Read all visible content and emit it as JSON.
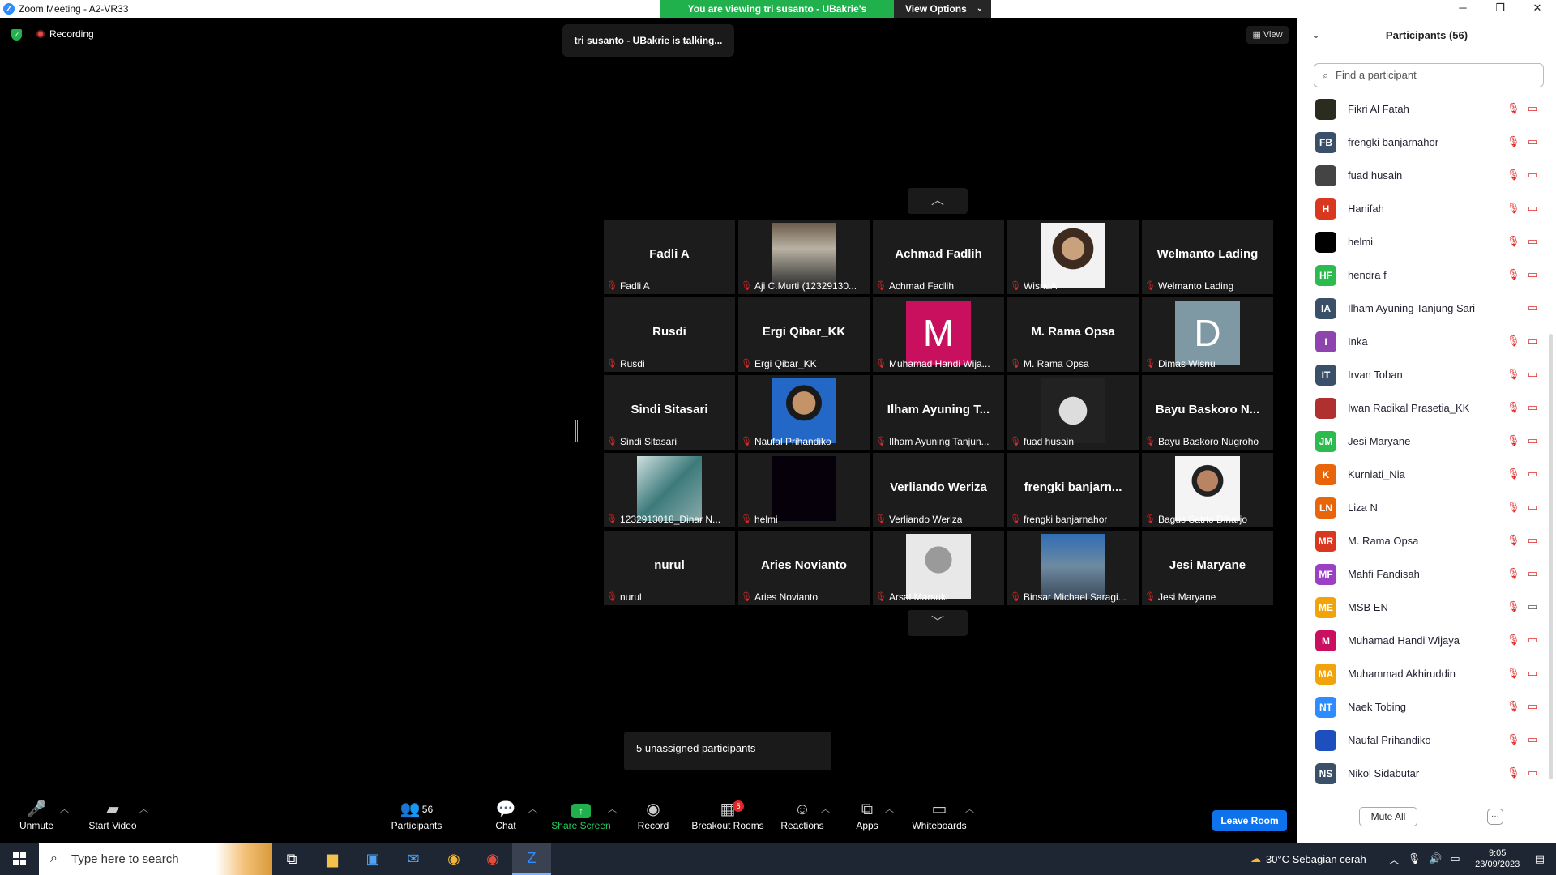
{
  "titlebar": {
    "title": "Zoom Meeting - A2-VR33",
    "banner_text": "You are viewing tri susanto - UBakrie's screen",
    "view_options": "View Options"
  },
  "meeting": {
    "recording_label": "Recording",
    "talking_text": "tri susanto - UBakrie is talking...",
    "view_label": "View",
    "unassigned_text": "5 unassigned participants"
  },
  "tiles": [
    {
      "big": "Fadli A",
      "label": "Fadli A"
    },
    {
      "photo": "photo",
      "label": "Aji C.Murti (12329130..."
    },
    {
      "big": "Achmad Fadlih",
      "label": "Achmad Fadlih"
    },
    {
      "photo": "photo",
      "label": "WisnuA"
    },
    {
      "big": "Welmanto Lading",
      "label": "Welmanto Lading"
    },
    {
      "big": "Rusdi",
      "label": "Rusdi"
    },
    {
      "big": "Ergi Qibar_KK",
      "label": "Ergi Qibar_KK"
    },
    {
      "letter": "M",
      "letter_color": "#c8105e",
      "label": "Muhamad Handi Wija..."
    },
    {
      "big": "M. Rama Opsa",
      "label": "M. Rama Opsa"
    },
    {
      "letter": "D",
      "letter_color": "#7e98a4",
      "label": "Dimas Wisnu"
    },
    {
      "big": "Sindi Sitasari",
      "label": "Sindi Sitasari"
    },
    {
      "photo": "photo",
      "label": "Naufal Prihandiko"
    },
    {
      "big": "Ilham Ayuning T...",
      "label": "Ilham Ayuning Tanjun..."
    },
    {
      "photo": "photo",
      "label": "fuad husain"
    },
    {
      "big": "Bayu Baskoro N...",
      "label": "Bayu Baskoro Nugroho"
    },
    {
      "photo": "photo",
      "label": "1232913018_Dinar N..."
    },
    {
      "photo": "photo",
      "label": "helmi"
    },
    {
      "big": "Verliando Weriza",
      "label": "Verliando Weriza"
    },
    {
      "big": "frengki  banjarn...",
      "label": "frengki banjarnahor"
    },
    {
      "photo": "photo",
      "label": "Bagus Satrio Diharjo"
    },
    {
      "big": "nurul",
      "label": "nurul"
    },
    {
      "big": "Aries Novianto",
      "label": "Aries Novianto"
    },
    {
      "photo": "photo",
      "label": "Arsal Marsuki"
    },
    {
      "photo": "photo",
      "label": "Binsar Michael Saragi..."
    },
    {
      "big": "Jesi Maryane",
      "label": "Jesi Maryane"
    }
  ],
  "toolbar": {
    "unmute": "Unmute",
    "start_video": "Start Video",
    "participants": "Participants",
    "participants_count": "56",
    "chat": "Chat",
    "share_screen": "Share Screen",
    "record": "Record",
    "breakout_rooms": "Breakout Rooms",
    "breakout_badge": "5",
    "reactions": "Reactions",
    "apps": "Apps",
    "whiteboards": "Whiteboards",
    "leave_room": "Leave Room"
  },
  "panel": {
    "title": "Participants (56)",
    "search_placeholder": "Find a participant",
    "mute_all": "Mute All",
    "participants": [
      {
        "initials": "",
        "color": "#2b2b20",
        "name": "Fikri Al Fatah",
        "video": "off"
      },
      {
        "initials": "FB",
        "color": "#3a5068",
        "name": "frengki banjarnahor",
        "video": "off"
      },
      {
        "initials": "",
        "color": "#444444",
        "name": "fuad husain",
        "video": "off"
      },
      {
        "initials": "H",
        "color": "#d9381e",
        "name": "Hanifah",
        "video": "off"
      },
      {
        "initials": "",
        "color": "#000000",
        "name": "helmi",
        "video": "off"
      },
      {
        "initials": "HF",
        "color": "#2dba4e",
        "name": "hendra f",
        "video": "off"
      },
      {
        "initials": "IA",
        "color": "#3a5068",
        "name": "Ilham Ayuning Tanjung Sari",
        "video": "off-only"
      },
      {
        "initials": "I",
        "color": "#8e44ad",
        "name": "Inka",
        "video": "off"
      },
      {
        "initials": "IT",
        "color": "#3a5068",
        "name": "Irvan Toban",
        "video": "off"
      },
      {
        "initials": "",
        "color": "#b03030",
        "name": "Iwan Radikal Prasetia_KK",
        "video": "off"
      },
      {
        "initials": "JM",
        "color": "#2dba4e",
        "name": "Jesi Maryane",
        "video": "off"
      },
      {
        "initials": "K",
        "color": "#e8650a",
        "name": "Kurniati_Nia",
        "video": "off"
      },
      {
        "initials": "LN",
        "color": "#e8650a",
        "name": "Liza N",
        "video": "off"
      },
      {
        "initials": "MR",
        "color": "#d9381e",
        "name": "M. Rama Opsa",
        "video": "off"
      },
      {
        "initials": "MF",
        "color": "#9b3fc4",
        "name": "Mahfi Fandisah",
        "video": "off"
      },
      {
        "initials": "ME",
        "color": "#f0a30a",
        "name": "MSB EN",
        "video": "on"
      },
      {
        "initials": "M",
        "color": "#c8105e",
        "name": "Muhamad Handi Wijaya",
        "video": "off"
      },
      {
        "initials": "MA",
        "color": "#f0a30a",
        "name": "Muhammad Akhiruddin",
        "video": "off"
      },
      {
        "initials": "NT",
        "color": "#2d8cff",
        "name": "Naek Tobing",
        "video": "off"
      },
      {
        "initials": "",
        "color": "#1e4fbf",
        "name": "Naufal Prihandiko",
        "video": "off"
      },
      {
        "initials": "NS",
        "color": "#3a5068",
        "name": "Nikol Sidabutar",
        "video": "off"
      }
    ]
  },
  "taskbar": {
    "search_placeholder": "Type here to search",
    "weather": "30°C  Sebagian cerah",
    "time": "9:05",
    "date": "23/09/2023"
  }
}
